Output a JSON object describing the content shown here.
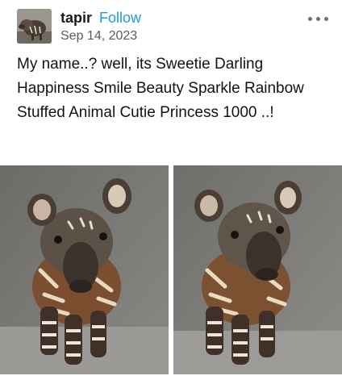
{
  "post": {
    "username": "tapir",
    "follow_label": "Follow",
    "date": "Sep 14, 2023",
    "body": "My name..? well, its Sweetie Darling Happiness Smile Beauty Sparkle Rainbow Stuffed Animal Cutie Princess 1000 ..!"
  },
  "icons": {
    "avatar": "tapir-avatar",
    "more": "more-options-icon"
  },
  "colors": {
    "follow": "#1e9be6",
    "text": "#121212",
    "date": "#5b5b5b"
  },
  "images": [
    "baby-tapir-photo-left",
    "baby-tapir-photo-right"
  ]
}
